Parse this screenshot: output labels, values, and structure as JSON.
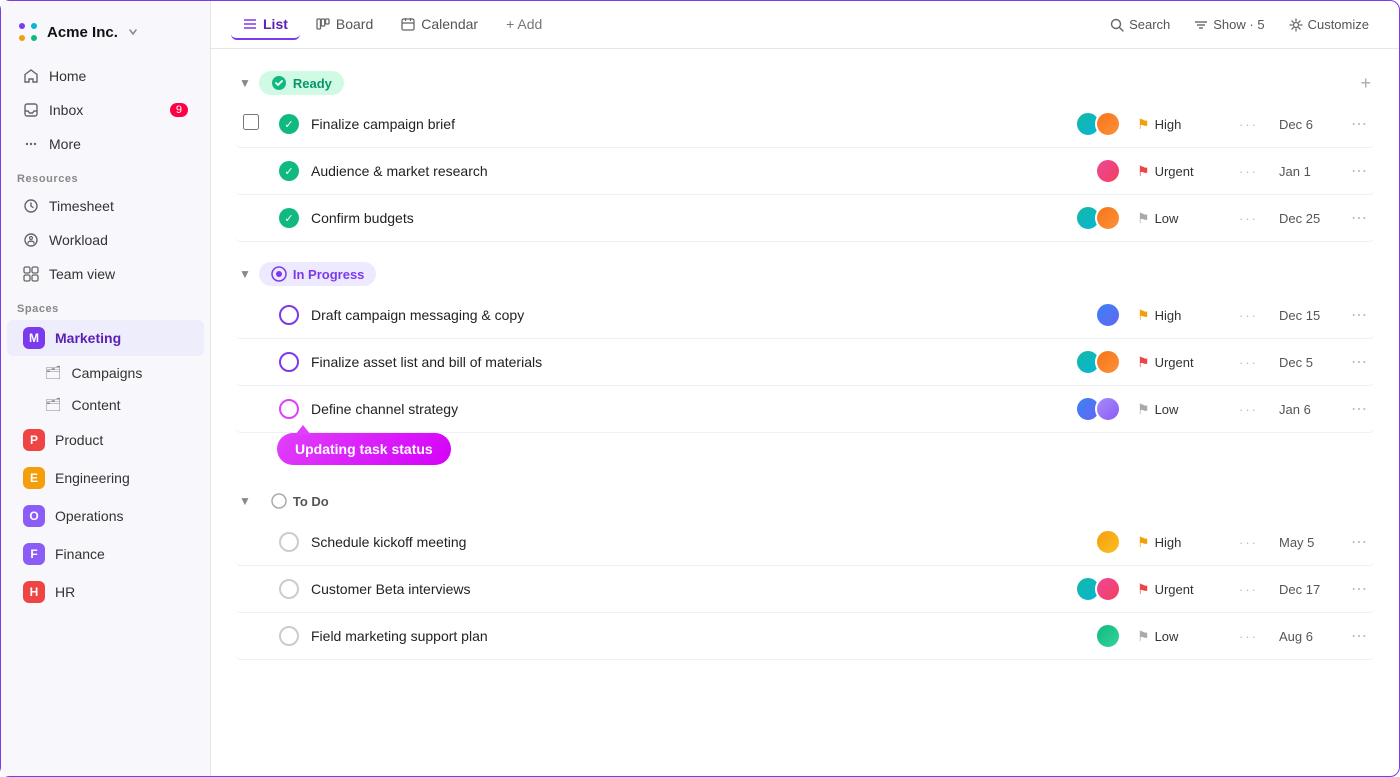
{
  "app": {
    "name": "Acme Inc.",
    "logo_label": "Acme Inc."
  },
  "sidebar": {
    "nav": [
      {
        "id": "home",
        "label": "Home",
        "icon": "home-icon",
        "badge": null
      },
      {
        "id": "inbox",
        "label": "Inbox",
        "icon": "inbox-icon",
        "badge": "9"
      },
      {
        "id": "more",
        "label": "More",
        "icon": "more-icon",
        "badge": null
      }
    ],
    "resources_label": "Resources",
    "resources": [
      {
        "id": "timesheet",
        "label": "Timesheet",
        "icon": "clock-icon"
      },
      {
        "id": "workload",
        "label": "Workload",
        "icon": "workload-icon"
      },
      {
        "id": "team-view",
        "label": "Team view",
        "icon": "team-icon"
      }
    ],
    "spaces_label": "Spaces",
    "spaces": [
      {
        "id": "marketing",
        "label": "Marketing",
        "letter": "M",
        "color_class": "m",
        "active": true
      },
      {
        "id": "product",
        "label": "Product",
        "letter": "P",
        "color_class": "p",
        "active": false
      },
      {
        "id": "engineering",
        "label": "Engineering",
        "letter": "E",
        "color_class": "e",
        "active": false
      },
      {
        "id": "operations",
        "label": "Operations",
        "letter": "O",
        "color_class": "o",
        "active": false
      },
      {
        "id": "finance",
        "label": "Finance",
        "letter": "F",
        "color_class": "f",
        "active": false
      },
      {
        "id": "hr",
        "label": "HR",
        "letter": "H",
        "color_class": "h",
        "active": false
      }
    ],
    "sub_items": [
      {
        "id": "campaigns",
        "label": "Campaigns"
      },
      {
        "id": "content",
        "label": "Content"
      }
    ]
  },
  "topbar": {
    "tabs": [
      {
        "id": "list",
        "label": "List",
        "active": true
      },
      {
        "id": "board",
        "label": "Board",
        "active": false
      },
      {
        "id": "calendar",
        "label": "Calendar",
        "active": false
      },
      {
        "id": "add",
        "label": "+ Add",
        "active": false
      }
    ],
    "search_label": "Search",
    "show_label": "Show · 5",
    "customize_label": "Customize"
  },
  "groups": [
    {
      "id": "ready",
      "label": "Ready",
      "type": "ready",
      "tasks": [
        {
          "id": "t1",
          "name": "Finalize campaign brief",
          "avatars": [
            "teal",
            "orange"
          ],
          "priority": "High",
          "priority_type": "high",
          "due": "Dec 6",
          "status": "done",
          "checkbox": true
        },
        {
          "id": "t2",
          "name": "Audience & market research",
          "avatars": [
            "pink"
          ],
          "priority": "Urgent",
          "priority_type": "urgent",
          "due": "Jan 1",
          "status": "done",
          "checkbox": false
        },
        {
          "id": "t3",
          "name": "Confirm budgets",
          "avatars": [
            "teal",
            "orange"
          ],
          "priority": "Low",
          "priority_type": "low",
          "due": "Dec 25",
          "status": "done",
          "checkbox": false
        }
      ]
    },
    {
      "id": "in-progress",
      "label": "In Progress",
      "type": "in-progress",
      "tasks": [
        {
          "id": "t4",
          "name": "Draft campaign messaging & copy",
          "avatars": [
            "blue"
          ],
          "priority": "High",
          "priority_type": "high",
          "due": "Dec 15",
          "status": "in-progress",
          "checkbox": false
        },
        {
          "id": "t5",
          "name": "Finalize asset list and bill of materials",
          "avatars": [
            "teal",
            "orange"
          ],
          "priority": "Urgent",
          "priority_type": "urgent",
          "due": "Dec 5",
          "status": "in-progress",
          "checkbox": false
        },
        {
          "id": "t6",
          "name": "Define channel strategy",
          "avatars": [
            "blue",
            "purple"
          ],
          "priority": "Low",
          "priority_type": "low",
          "due": "Jan 6",
          "status": "in-progress",
          "tooltip": "Updating task status",
          "checkbox": false
        }
      ]
    },
    {
      "id": "todo",
      "label": "To Do",
      "type": "todo",
      "tasks": [
        {
          "id": "t7",
          "name": "Schedule kickoff meeting",
          "avatars": [
            "yellow"
          ],
          "priority": "High",
          "priority_type": "high",
          "due": "May 5",
          "status": "todo",
          "checkbox": false
        },
        {
          "id": "t8",
          "name": "Customer Beta interviews",
          "avatars": [
            "teal",
            "pink"
          ],
          "priority": "Urgent",
          "priority_type": "urgent",
          "due": "Dec 17",
          "status": "todo",
          "checkbox": false
        },
        {
          "id": "t9",
          "name": "Field marketing support plan",
          "avatars": [
            "green"
          ],
          "priority": "Low",
          "priority_type": "low",
          "due": "Aug 6",
          "status": "todo",
          "checkbox": false
        }
      ]
    }
  ]
}
